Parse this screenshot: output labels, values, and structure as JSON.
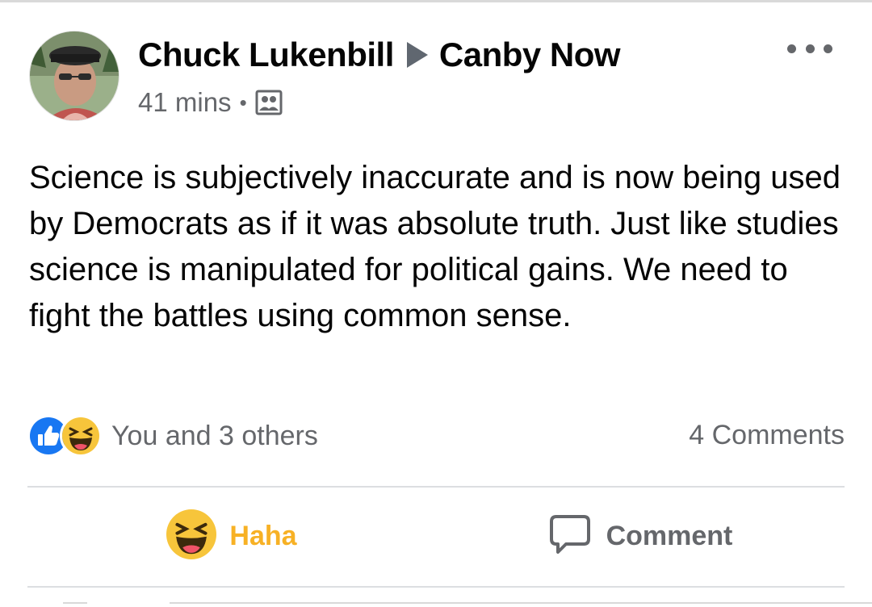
{
  "post": {
    "author": "Chuck Lukenbill",
    "group": "Canby Now",
    "time": "41 mins",
    "separator": "•",
    "audience_icon": "group-audience-icon",
    "text": "Science is subjectively inaccurate and is now being used by Democrats as if it was absolute truth. Just like studies science is manipulated for political gains. We need to fight the battles using common sense."
  },
  "reactions": {
    "icons": [
      "like-icon",
      "haha-icon"
    ],
    "summary": "You and 3 others",
    "comments": "4 Comments"
  },
  "actions": {
    "haha_label": "Haha",
    "comment_label": "Comment"
  },
  "colors": {
    "haha_active": "#f7b125",
    "secondary_text": "#65676b",
    "like_blue": "#1877f2",
    "divider": "#dcdee1"
  }
}
